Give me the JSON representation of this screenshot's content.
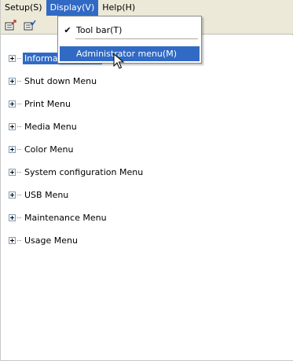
{
  "menubar": {
    "setup": "Setup(S)",
    "display": "Display(V)",
    "help": "Help(H)"
  },
  "toolbar": {
    "buttons": [
      "edit-icon",
      "edit-check-icon"
    ]
  },
  "dropdown": {
    "toolbar_item": "Tool bar(T)",
    "toolbar_checked": true,
    "admin_item": "Administrator menu(M)"
  },
  "tree": {
    "items": [
      "Information Menu",
      "Shut down Menu",
      "Print Menu",
      "Media Menu",
      "Color Menu",
      "System configuration Menu",
      "USB Menu",
      "Maintenance Menu",
      "Usage Menu"
    ]
  },
  "colors": {
    "highlight": "#316ac5",
    "chrome": "#ece9d8"
  }
}
